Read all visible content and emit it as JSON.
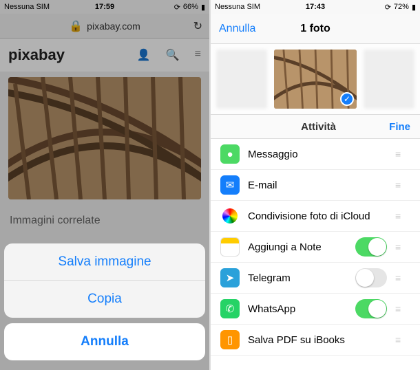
{
  "left": {
    "status": {
      "carrier": "Nessuna SIM",
      "time": "17:59",
      "battery": "66%"
    },
    "url": "pixabay.com",
    "logo": "pixabay",
    "related_label": "Immagini correlate",
    "action_sheet": {
      "save": "Salva immagine",
      "copy": "Copia",
      "cancel": "Annulla"
    }
  },
  "right": {
    "status": {
      "carrier": "Nessuna SIM",
      "time": "17:43",
      "battery": "72%"
    },
    "nav": {
      "cancel": "Annulla",
      "title": "1 foto"
    },
    "section": {
      "title": "Attività",
      "done": "Fine"
    },
    "rows": [
      {
        "key": "messaggio",
        "label": "Messaggio",
        "color": "#4cd964",
        "glyph": "●",
        "control": "grip"
      },
      {
        "key": "email",
        "label": "E-mail",
        "color": "#147efb",
        "glyph": "✉",
        "control": "grip"
      },
      {
        "key": "icloud",
        "label": "Condivisione foto di iCloud",
        "color": "#fff",
        "glyph": "photos",
        "control": "grip"
      },
      {
        "key": "note",
        "label": "Aggiungi a Note",
        "color": "#fff",
        "glyph": "note",
        "control": "toggle-on"
      },
      {
        "key": "telegram",
        "label": "Telegram",
        "color": "#2aa1da",
        "glyph": "➤",
        "control": "toggle-off"
      },
      {
        "key": "whatsapp",
        "label": "WhatsApp",
        "color": "#25d366",
        "glyph": "✆",
        "control": "toggle-on"
      },
      {
        "key": "ibooks",
        "label": "Salva PDF su iBooks",
        "color": "#ff9500",
        "glyph": "▯",
        "control": "grip"
      }
    ]
  }
}
